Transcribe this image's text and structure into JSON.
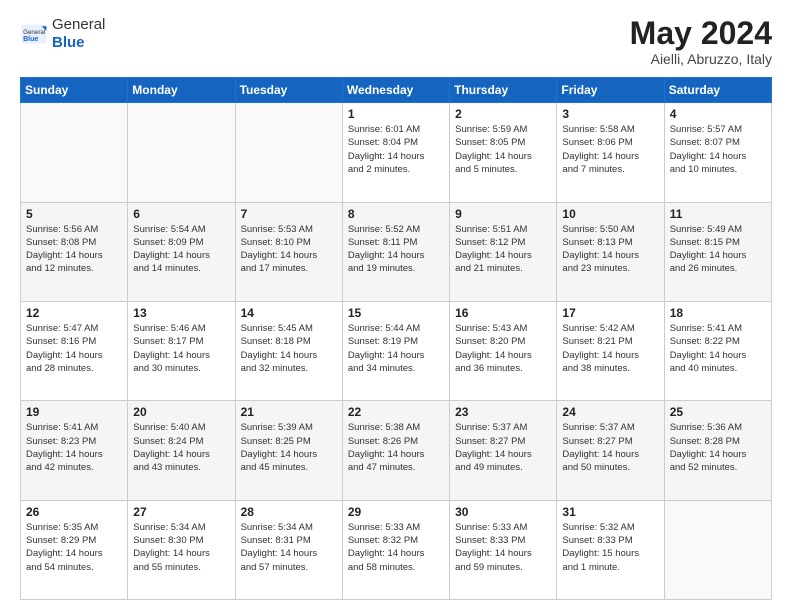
{
  "header": {
    "logo_general": "General",
    "logo_blue": "Blue",
    "month": "May 2024",
    "location": "Aielli, Abruzzo, Italy"
  },
  "weekdays": [
    "Sunday",
    "Monday",
    "Tuesday",
    "Wednesday",
    "Thursday",
    "Friday",
    "Saturday"
  ],
  "weeks": [
    [
      {
        "day": "",
        "info": ""
      },
      {
        "day": "",
        "info": ""
      },
      {
        "day": "",
        "info": ""
      },
      {
        "day": "1",
        "info": "Sunrise: 6:01 AM\nSunset: 8:04 PM\nDaylight: 14 hours\nand 2 minutes."
      },
      {
        "day": "2",
        "info": "Sunrise: 5:59 AM\nSunset: 8:05 PM\nDaylight: 14 hours\nand 5 minutes."
      },
      {
        "day": "3",
        "info": "Sunrise: 5:58 AM\nSunset: 8:06 PM\nDaylight: 14 hours\nand 7 minutes."
      },
      {
        "day": "4",
        "info": "Sunrise: 5:57 AM\nSunset: 8:07 PM\nDaylight: 14 hours\nand 10 minutes."
      }
    ],
    [
      {
        "day": "5",
        "info": "Sunrise: 5:56 AM\nSunset: 8:08 PM\nDaylight: 14 hours\nand 12 minutes."
      },
      {
        "day": "6",
        "info": "Sunrise: 5:54 AM\nSunset: 8:09 PM\nDaylight: 14 hours\nand 14 minutes."
      },
      {
        "day": "7",
        "info": "Sunrise: 5:53 AM\nSunset: 8:10 PM\nDaylight: 14 hours\nand 17 minutes."
      },
      {
        "day": "8",
        "info": "Sunrise: 5:52 AM\nSunset: 8:11 PM\nDaylight: 14 hours\nand 19 minutes."
      },
      {
        "day": "9",
        "info": "Sunrise: 5:51 AM\nSunset: 8:12 PM\nDaylight: 14 hours\nand 21 minutes."
      },
      {
        "day": "10",
        "info": "Sunrise: 5:50 AM\nSunset: 8:13 PM\nDaylight: 14 hours\nand 23 minutes."
      },
      {
        "day": "11",
        "info": "Sunrise: 5:49 AM\nSunset: 8:15 PM\nDaylight: 14 hours\nand 26 minutes."
      }
    ],
    [
      {
        "day": "12",
        "info": "Sunrise: 5:47 AM\nSunset: 8:16 PM\nDaylight: 14 hours\nand 28 minutes."
      },
      {
        "day": "13",
        "info": "Sunrise: 5:46 AM\nSunset: 8:17 PM\nDaylight: 14 hours\nand 30 minutes."
      },
      {
        "day": "14",
        "info": "Sunrise: 5:45 AM\nSunset: 8:18 PM\nDaylight: 14 hours\nand 32 minutes."
      },
      {
        "day": "15",
        "info": "Sunrise: 5:44 AM\nSunset: 8:19 PM\nDaylight: 14 hours\nand 34 minutes."
      },
      {
        "day": "16",
        "info": "Sunrise: 5:43 AM\nSunset: 8:20 PM\nDaylight: 14 hours\nand 36 minutes."
      },
      {
        "day": "17",
        "info": "Sunrise: 5:42 AM\nSunset: 8:21 PM\nDaylight: 14 hours\nand 38 minutes."
      },
      {
        "day": "18",
        "info": "Sunrise: 5:41 AM\nSunset: 8:22 PM\nDaylight: 14 hours\nand 40 minutes."
      }
    ],
    [
      {
        "day": "19",
        "info": "Sunrise: 5:41 AM\nSunset: 8:23 PM\nDaylight: 14 hours\nand 42 minutes."
      },
      {
        "day": "20",
        "info": "Sunrise: 5:40 AM\nSunset: 8:24 PM\nDaylight: 14 hours\nand 43 minutes."
      },
      {
        "day": "21",
        "info": "Sunrise: 5:39 AM\nSunset: 8:25 PM\nDaylight: 14 hours\nand 45 minutes."
      },
      {
        "day": "22",
        "info": "Sunrise: 5:38 AM\nSunset: 8:26 PM\nDaylight: 14 hours\nand 47 minutes."
      },
      {
        "day": "23",
        "info": "Sunrise: 5:37 AM\nSunset: 8:27 PM\nDaylight: 14 hours\nand 49 minutes."
      },
      {
        "day": "24",
        "info": "Sunrise: 5:37 AM\nSunset: 8:27 PM\nDaylight: 14 hours\nand 50 minutes."
      },
      {
        "day": "25",
        "info": "Sunrise: 5:36 AM\nSunset: 8:28 PM\nDaylight: 14 hours\nand 52 minutes."
      }
    ],
    [
      {
        "day": "26",
        "info": "Sunrise: 5:35 AM\nSunset: 8:29 PM\nDaylight: 14 hours\nand 54 minutes."
      },
      {
        "day": "27",
        "info": "Sunrise: 5:34 AM\nSunset: 8:30 PM\nDaylight: 14 hours\nand 55 minutes."
      },
      {
        "day": "28",
        "info": "Sunrise: 5:34 AM\nSunset: 8:31 PM\nDaylight: 14 hours\nand 57 minutes."
      },
      {
        "day": "29",
        "info": "Sunrise: 5:33 AM\nSunset: 8:32 PM\nDaylight: 14 hours\nand 58 minutes."
      },
      {
        "day": "30",
        "info": "Sunrise: 5:33 AM\nSunset: 8:33 PM\nDaylight: 14 hours\nand 59 minutes."
      },
      {
        "day": "31",
        "info": "Sunrise: 5:32 AM\nSunset: 8:33 PM\nDaylight: 15 hours\nand 1 minute."
      },
      {
        "day": "",
        "info": ""
      }
    ]
  ]
}
